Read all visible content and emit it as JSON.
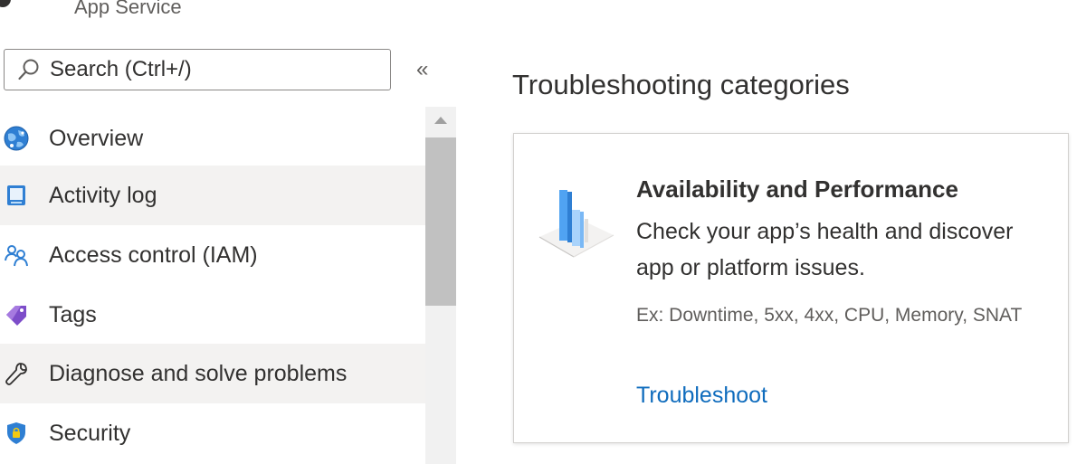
{
  "header": {
    "service_name": "App Service"
  },
  "search": {
    "placeholder": "Search (Ctrl+/)",
    "collapse_glyph": "«"
  },
  "sidebar": {
    "items": [
      {
        "label": "Overview",
        "icon": "globe-icon",
        "highlighted": false
      },
      {
        "label": "Activity log",
        "icon": "activity-log-icon",
        "highlighted": true
      },
      {
        "label": "Access control (IAM)",
        "icon": "people-icon",
        "highlighted": false
      },
      {
        "label": "Tags",
        "icon": "tag-icon",
        "highlighted": false
      },
      {
        "label": "Diagnose and solve problems",
        "icon": "wrench-icon",
        "highlighted": true
      },
      {
        "label": "Security",
        "icon": "shield-icon",
        "highlighted": false
      }
    ]
  },
  "main": {
    "title": "Troubleshooting categories",
    "card": {
      "title": "Availability and Performance",
      "description": "Check your app’s health and discover app or platform issues.",
      "examples": "Ex: Downtime, 5xx, 4xx, CPU, Memory, SNAT",
      "link": "Troubleshoot",
      "illustration": "bar-chart-icon"
    }
  },
  "colors": {
    "accent": "#0f6cbd",
    "highlight_bg": "#f3f2f1",
    "text": "#323130",
    "secondary_text": "#605e5c"
  }
}
